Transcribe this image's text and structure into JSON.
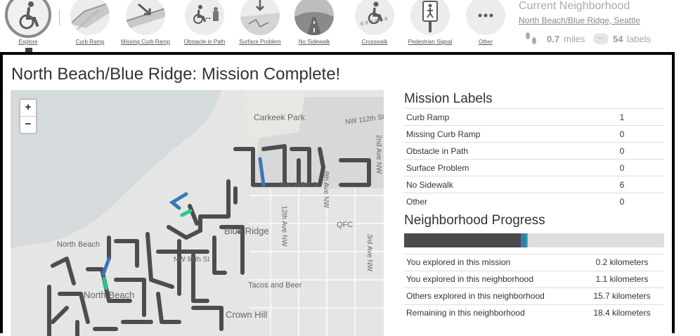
{
  "toolbar": {
    "tools": [
      {
        "label": "Explore",
        "icon": "wheelchair-icon"
      },
      {
        "label": "Curb Ramp",
        "icon": "curb-ramp-icon"
      },
      {
        "label": "Missing Curb Ramp",
        "icon": "missing-curb-ramp-icon"
      },
      {
        "label": "Obstacle in Path",
        "icon": "obstacle-icon"
      },
      {
        "label": "Surface Problem",
        "icon": "surface-problem-icon"
      },
      {
        "label": "No Sidewalk",
        "icon": "no-sidewalk-icon"
      },
      {
        "label": "Crosswalk",
        "icon": "crosswalk-icon"
      },
      {
        "label": "Pedestrian Signal",
        "icon": "pedestrian-signal-icon"
      },
      {
        "label": "Other",
        "icon": "ellipsis-icon"
      }
    ]
  },
  "status": {
    "title": "Current Neighborhood",
    "neighborhood_link": "North Beach/Blue Ridge, Seattle",
    "miles_value": "0.7",
    "miles_unit": "miles",
    "labels_icon_text": "...",
    "labels_value": "54",
    "labels_unit": "labels"
  },
  "modal": {
    "title": "North Beach/Blue Ridge: Mission Complete!",
    "map": {
      "zoom_in": "+",
      "zoom_out": "−",
      "labels": {
        "carkeek": "Carkeek Park",
        "nw112": "NW 112th St",
        "ave2": "2nd Ave NW",
        "nw105": "NW 105th St",
        "ave8": "8th Ave NW",
        "ave12": "12th Ave NW",
        "qfc": "QFC",
        "blue_ridge": "Blue Ridge",
        "ave3": "3rd Ave NW",
        "north_beach_top": "North Beach",
        "nw95": "NW 95th St",
        "tacos": "Tacos and Beer",
        "north_beach": "North Beach",
        "crown_hill": "Crown Hill"
      }
    },
    "mission_labels": {
      "heading": "Mission Labels",
      "rows": [
        {
          "label": "Curb Ramp",
          "value": "1"
        },
        {
          "label": "Missing Curb Ramp",
          "value": "0"
        },
        {
          "label": "Obstacle in Path",
          "value": "0"
        },
        {
          "label": "Surface Problem",
          "value": "0"
        },
        {
          "label": "No Sidewalk",
          "value": "6"
        },
        {
          "label": "Other",
          "value": "0"
        }
      ]
    },
    "progress": {
      "heading": "Neighborhood Progress",
      "others_fraction": 0.448,
      "you_neighborhood_fraction": 0.022,
      "you_mission_fraction": 0.006,
      "colors": {
        "others": "#4a4a4a",
        "you_neighborhood": "#3a77b9",
        "you_mission": "#20c98a",
        "remaining": "#dedede"
      },
      "rows": [
        {
          "label": "You explored in this mission",
          "value": "0.2 kilometers"
        },
        {
          "label": "You explored in this neighborhood",
          "value": "1.1 kilometers"
        },
        {
          "label": "Others explored in this neighborhood",
          "value": "15.7 kilometers"
        },
        {
          "label": "Remaining in this neighborhood",
          "value": "18.4 kilometers"
        }
      ]
    }
  }
}
